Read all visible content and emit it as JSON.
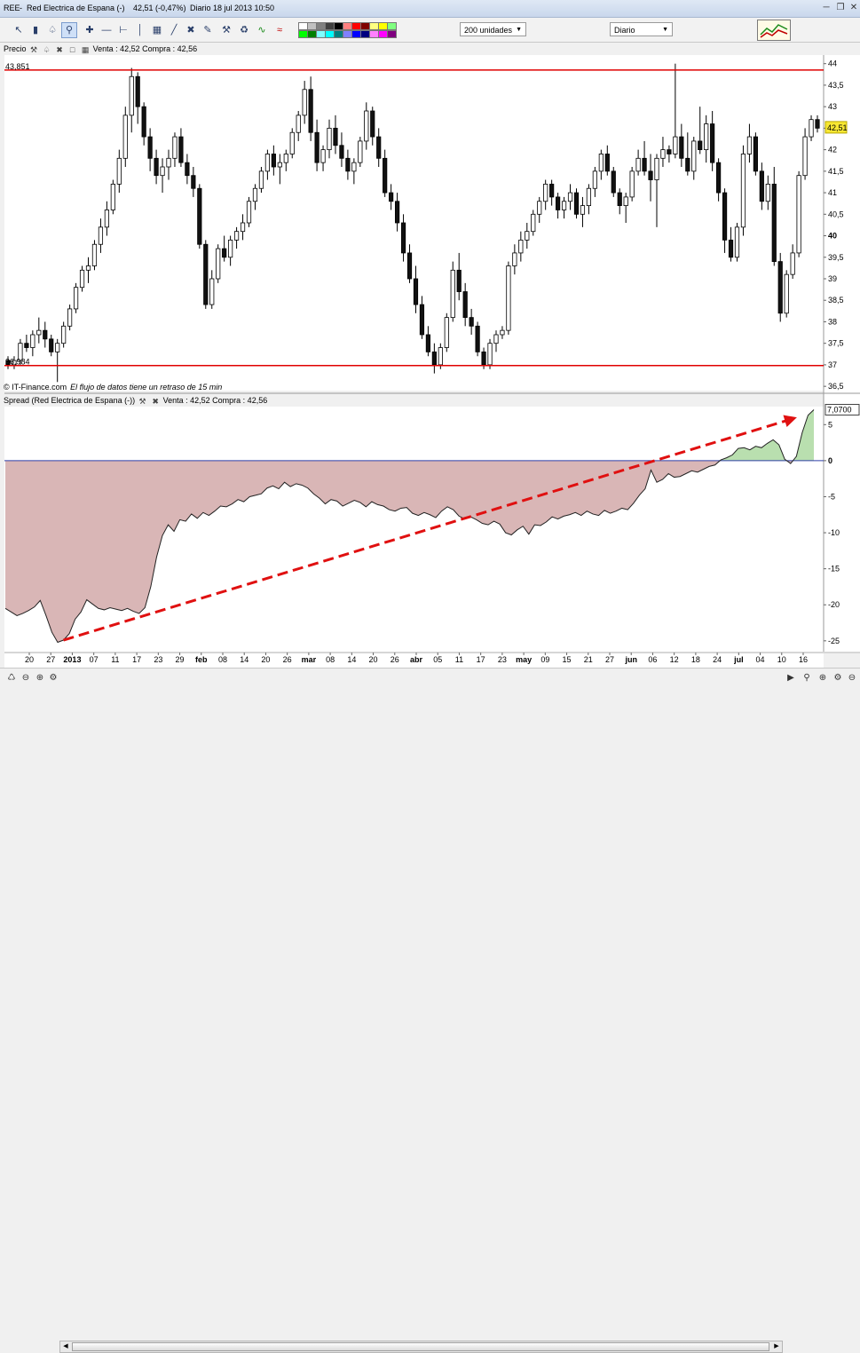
{
  "window": {
    "ticker": "REE",
    "name": "Red Electrica de Espana (-)",
    "change": "42,51 (-0,47%)",
    "period": "Diario",
    "datetime": "18 jul 2013 10:50"
  },
  "toolbar": {
    "icons": [
      "cursor-icon",
      "ruler-icon",
      "alarm-icon",
      "magnifier-icon",
      "crosshair-icon",
      "horizontal-line-icon",
      "vertical-line-icon",
      "fibonacci-icon",
      "channel-icon",
      "cross-tool-icon",
      "hammer-icon",
      "trash-icon",
      "indicator-line-icon",
      "indicator-area-icon"
    ],
    "units_select": "200 unidades",
    "period_select": "Diario",
    "swatch_colors": [
      "#ffffff",
      "#c0c0c0",
      "#808080",
      "#404040",
      "#000000",
      "#ff8080",
      "#ff0000",
      "#800000",
      "#ffff80",
      "#ffff00",
      "#80ff80",
      "#00ff00",
      "#008000",
      "#80ffff",
      "#00ffff",
      "#008080",
      "#8080ff",
      "#0000ff",
      "#000080",
      "#ff80ff",
      "#ff00ff",
      "#800080"
    ]
  },
  "price_pane": {
    "label": "Precio",
    "quote": "Venta : 42,52  Compra : 42,56",
    "level_high": "43,851",
    "level_low": "36,984",
    "current_price": "42,51",
    "credit": "© IT-Finance.com",
    "delay_note": "El flujo de datos tiene un retraso de 15 min"
  },
  "spread_pane": {
    "label": "Spread (Red Electrica de Espana (-))",
    "quote": "Venta : 42,52  Compra : 42,56",
    "current_value": "7,0700"
  },
  "chart_data": [
    {
      "type": "candlestick",
      "title": "Precio",
      "ylim": [
        36.4,
        44.2
      ],
      "y_ticks": [
        "36,5",
        "37",
        "37,5",
        "38",
        "38,5",
        "39",
        "39,5",
        "40",
        "40,5",
        "41",
        "41,5",
        "42",
        "42,5",
        "43",
        "43,5",
        "44"
      ],
      "x_tick_labels": [
        "20",
        "27",
        "2013",
        "07",
        "11",
        "17",
        "23",
        "29",
        "feb",
        "08",
        "14",
        "20",
        "26",
        "mar",
        "08",
        "14",
        "20",
        "26",
        "abr",
        "05",
        "11",
        "17",
        "23",
        "may",
        "09",
        "15",
        "21",
        "27",
        "jun",
        "06",
        "12",
        "18",
        "24",
        "jul",
        "04",
        "10",
        "16"
      ],
      "horizontal_levels": [
        43.851,
        36.984
      ],
      "last_price": 42.51,
      "ohlc": [
        [
          37.1,
          37.2,
          36.9,
          37.0
        ],
        [
          37.0,
          37.2,
          36.9,
          37.1
        ],
        [
          37.1,
          37.6,
          37.0,
          37.5
        ],
        [
          37.5,
          37.7,
          37.3,
          37.4
        ],
        [
          37.4,
          37.8,
          37.2,
          37.7
        ],
        [
          37.7,
          38.1,
          37.5,
          37.8
        ],
        [
          37.8,
          38.0,
          37.4,
          37.6
        ],
        [
          37.6,
          37.7,
          37.2,
          37.3
        ],
        [
          37.3,
          37.6,
          36.6,
          37.5
        ],
        [
          37.5,
          38.0,
          37.4,
          37.9
        ],
        [
          37.9,
          38.4,
          37.8,
          38.3
        ],
        [
          38.3,
          38.9,
          38.2,
          38.8
        ],
        [
          38.8,
          39.3,
          38.7,
          39.2
        ],
        [
          39.2,
          39.5,
          38.9,
          39.3
        ],
        [
          39.3,
          39.9,
          39.2,
          39.8
        ],
        [
          39.8,
          40.4,
          39.6,
          40.2
        ],
        [
          40.2,
          40.8,
          40.0,
          40.6
        ],
        [
          40.6,
          41.3,
          40.5,
          41.2
        ],
        [
          41.2,
          42.0,
          41.0,
          41.8
        ],
        [
          41.8,
          43.0,
          41.6,
          42.8
        ],
        [
          42.8,
          43.9,
          42.4,
          43.7
        ],
        [
          43.7,
          43.8,
          42.6,
          43.0
        ],
        [
          43.0,
          43.1,
          42.1,
          42.3
        ],
        [
          42.3,
          42.5,
          41.5,
          41.8
        ],
        [
          41.8,
          42.0,
          41.2,
          41.4
        ],
        [
          41.4,
          41.8,
          41.0,
          41.6
        ],
        [
          41.6,
          42.0,
          41.3,
          41.8
        ],
        [
          41.8,
          42.4,
          41.6,
          42.3
        ],
        [
          42.3,
          42.5,
          41.6,
          41.7
        ],
        [
          41.7,
          41.9,
          41.2,
          41.4
        ],
        [
          41.4,
          41.6,
          40.9,
          41.1
        ],
        [
          41.1,
          41.2,
          39.7,
          39.8
        ],
        [
          39.8,
          39.9,
          38.3,
          38.4
        ],
        [
          38.4,
          39.2,
          38.3,
          39.0
        ],
        [
          39.0,
          39.8,
          38.9,
          39.7
        ],
        [
          39.7,
          40.0,
          39.4,
          39.5
        ],
        [
          39.5,
          40.0,
          39.3,
          39.9
        ],
        [
          39.9,
          40.2,
          39.7,
          40.1
        ],
        [
          40.1,
          40.5,
          39.9,
          40.3
        ],
        [
          40.3,
          40.9,
          40.2,
          40.8
        ],
        [
          40.8,
          41.2,
          40.6,
          41.1
        ],
        [
          41.1,
          41.6,
          41.0,
          41.5
        ],
        [
          41.5,
          42.0,
          41.3,
          41.9
        ],
        [
          41.9,
          42.1,
          41.4,
          41.6
        ],
        [
          41.6,
          41.9,
          41.2,
          41.7
        ],
        [
          41.7,
          42.0,
          41.5,
          41.9
        ],
        [
          41.9,
          42.5,
          41.8,
          42.4
        ],
        [
          42.4,
          42.9,
          42.2,
          42.8
        ],
        [
          42.8,
          43.6,
          42.6,
          43.4
        ],
        [
          43.4,
          43.7,
          42.2,
          42.4
        ],
        [
          42.4,
          42.7,
          41.5,
          41.7
        ],
        [
          41.7,
          42.1,
          41.5,
          42.0
        ],
        [
          42.0,
          42.7,
          41.8,
          42.5
        ],
        [
          42.5,
          42.8,
          41.9,
          42.1
        ],
        [
          42.1,
          42.4,
          41.6,
          41.8
        ],
        [
          41.8,
          42.0,
          41.3,
          41.5
        ],
        [
          41.5,
          41.8,
          41.2,
          41.7
        ],
        [
          41.7,
          42.3,
          41.6,
          42.2
        ],
        [
          42.2,
          43.1,
          42.0,
          42.9
        ],
        [
          42.9,
          43.0,
          42.1,
          42.3
        ],
        [
          42.3,
          42.5,
          41.6,
          41.8
        ],
        [
          41.8,
          42.0,
          40.9,
          41.0
        ],
        [
          41.0,
          41.2,
          40.6,
          40.8
        ],
        [
          40.8,
          41.0,
          40.1,
          40.3
        ],
        [
          40.3,
          40.5,
          39.4,
          39.6
        ],
        [
          39.6,
          39.8,
          38.9,
          39.0
        ],
        [
          39.0,
          39.3,
          38.2,
          38.4
        ],
        [
          38.4,
          38.6,
          37.6,
          37.7
        ],
        [
          37.7,
          37.9,
          37.2,
          37.3
        ],
        [
          37.3,
          37.5,
          36.8,
          37.0
        ],
        [
          37.0,
          37.5,
          36.9,
          37.4
        ],
        [
          37.4,
          38.2,
          37.3,
          38.1
        ],
        [
          38.1,
          39.4,
          38.0,
          39.2
        ],
        [
          39.2,
          39.6,
          38.5,
          38.7
        ],
        [
          38.7,
          38.9,
          37.9,
          38.1
        ],
        [
          38.1,
          38.3,
          37.7,
          37.9
        ],
        [
          37.9,
          38.0,
          37.2,
          37.3
        ],
        [
          37.3,
          37.4,
          36.9,
          37.0
        ],
        [
          37.0,
          37.6,
          36.9,
          37.5
        ],
        [
          37.5,
          37.8,
          37.3,
          37.7
        ],
        [
          37.7,
          37.9,
          37.6,
          37.8
        ],
        [
          37.8,
          39.4,
          37.7,
          39.3
        ],
        [
          39.3,
          39.8,
          39.1,
          39.6
        ],
        [
          39.6,
          40.1,
          39.4,
          39.9
        ],
        [
          39.9,
          40.3,
          39.7,
          40.1
        ],
        [
          40.1,
          40.6,
          40.0,
          40.5
        ],
        [
          40.5,
          40.9,
          40.3,
          40.8
        ],
        [
          40.8,
          41.3,
          40.6,
          41.2
        ],
        [
          41.2,
          41.3,
          40.7,
          40.9
        ],
        [
          40.9,
          41.0,
          40.4,
          40.6
        ],
        [
          40.6,
          40.9,
          40.4,
          40.8
        ],
        [
          40.8,
          41.2,
          40.6,
          41.0
        ],
        [
          41.0,
          41.1,
          40.4,
          40.5
        ],
        [
          40.5,
          40.9,
          40.2,
          40.7
        ],
        [
          40.7,
          41.2,
          40.5,
          41.1
        ],
        [
          41.1,
          41.6,
          40.9,
          41.5
        ],
        [
          41.5,
          42.0,
          41.3,
          41.9
        ],
        [
          41.9,
          42.1,
          41.4,
          41.5
        ],
        [
          41.5,
          41.6,
          40.9,
          41.0
        ],
        [
          41.0,
          41.1,
          40.5,
          40.7
        ],
        [
          40.7,
          41.0,
          40.3,
          40.9
        ],
        [
          40.9,
          41.6,
          40.8,
          41.5
        ],
        [
          41.5,
          42.0,
          41.4,
          41.8
        ],
        [
          41.8,
          42.2,
          41.4,
          41.5
        ],
        [
          41.5,
          41.9,
          40.8,
          41.3
        ],
        [
          41.3,
          41.9,
          40.2,
          41.8
        ],
        [
          41.8,
          42.3,
          41.6,
          42.0
        ],
        [
          42.0,
          42.1,
          41.7,
          41.9
        ],
        [
          41.9,
          44.0,
          41.8,
          42.3
        ],
        [
          42.3,
          42.6,
          41.6,
          41.8
        ],
        [
          41.8,
          42.4,
          41.4,
          41.5
        ],
        [
          41.5,
          42.3,
          41.3,
          42.2
        ],
        [
          42.2,
          43.0,
          41.9,
          42.0
        ],
        [
          42.0,
          42.8,
          41.7,
          42.6
        ],
        [
          42.6,
          42.9,
          41.5,
          41.7
        ],
        [
          41.7,
          41.8,
          40.8,
          41.0
        ],
        [
          41.0,
          41.1,
          39.6,
          39.9
        ],
        [
          39.9,
          40.2,
          39.4,
          39.5
        ],
        [
          39.5,
          40.3,
          39.4,
          40.2
        ],
        [
          40.2,
          42.1,
          40.0,
          41.9
        ],
        [
          41.9,
          42.6,
          41.7,
          42.3
        ],
        [
          42.3,
          42.4,
          41.4,
          41.5
        ],
        [
          41.5,
          41.7,
          40.6,
          40.8
        ],
        [
          40.8,
          41.4,
          40.6,
          41.2
        ],
        [
          41.2,
          41.6,
          39.3,
          39.4
        ],
        [
          39.4,
          39.6,
          38.0,
          38.2
        ],
        [
          38.2,
          39.2,
          38.1,
          39.1
        ],
        [
          39.1,
          39.8,
          39.0,
          39.6
        ],
        [
          39.6,
          41.5,
          39.5,
          41.4
        ],
        [
          41.4,
          42.5,
          41.3,
          42.3
        ],
        [
          42.3,
          42.8,
          42.2,
          42.7
        ],
        [
          42.7,
          42.8,
          42.4,
          42.5
        ]
      ]
    },
    {
      "type": "area",
      "title": "Spread (Red Electrica de Espana (-))",
      "ylim": [
        -26.5,
        7.5
      ],
      "y_ticks": [
        "-25",
        "-20",
        "-15",
        "-10",
        "-5",
        "0",
        "5"
      ],
      "baseline": 0,
      "last_value": 7.07,
      "values": [
        -20.5,
        -21.0,
        -21.5,
        -21.2,
        -20.8,
        -20.3,
        -19.4,
        -21.5,
        -23.8,
        -25.2,
        -24.9,
        -24.0,
        -22.0,
        -21.0,
        -19.3,
        -19.9,
        -20.5,
        -20.7,
        -20.4,
        -20.6,
        -20.8,
        -20.5,
        -20.9,
        -21.2,
        -20.4,
        -17.5,
        -13.4,
        -10.4,
        -8.9,
        -9.8,
        -8.2,
        -8.4,
        -7.4,
        -8.0,
        -7.2,
        -7.6,
        -7.0,
        -6.3,
        -6.4,
        -6.0,
        -5.4,
        -5.7,
        -5.0,
        -4.8,
        -4.6,
        -3.8,
        -3.5,
        -3.9,
        -3.0,
        -3.6,
        -3.2,
        -3.4,
        -3.8,
        -4.6,
        -5.2,
        -6.0,
        -5.4,
        -5.6,
        -6.3,
        -5.9,
        -5.5,
        -5.8,
        -6.4,
        -5.7,
        -6.1,
        -6.3,
        -6.8,
        -7.0,
        -6.6,
        -6.5,
        -7.3,
        -7.6,
        -7.2,
        -7.5,
        -7.9,
        -7.0,
        -6.4,
        -6.8,
        -7.7,
        -8.1,
        -7.8,
        -8.2,
        -8.7,
        -8.9,
        -8.4,
        -8.8,
        -10.0,
        -10.3,
        -9.6,
        -9.1,
        -10.2,
        -8.9,
        -9.0,
        -8.5,
        -7.8,
        -8.1,
        -7.7,
        -7.5,
        -7.2,
        -7.6,
        -7.0,
        -7.4,
        -7.6,
        -6.9,
        -7.3,
        -7.0,
        -6.6,
        -6.8,
        -5.9,
        -4.8,
        -3.9,
        -1.3,
        -3.0,
        -2.6,
        -1.8,
        -2.3,
        -2.2,
        -1.8,
        -1.4,
        -1.6,
        -1.2,
        -0.8,
        -0.6,
        0.1,
        0.4,
        0.8,
        1.7,
        1.8,
        1.5,
        2.0,
        1.8,
        2.4,
        2.9,
        2.2,
        0.2,
        -0.4,
        0.6,
        3.9,
        6.3,
        7.07
      ],
      "trend_arrow": {
        "start_value": -24.9,
        "end_value": 6.0
      }
    }
  ]
}
